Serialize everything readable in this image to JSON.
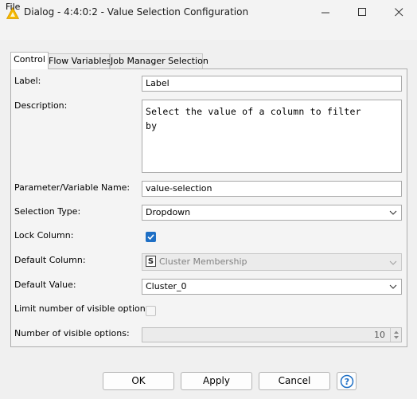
{
  "window": {
    "title": "Dialog - 4:4:0:2 - Value Selection Configuration",
    "minimize_icon": "minimize-icon",
    "maximize_icon": "maximize-icon",
    "close_icon": "close-icon"
  },
  "menu": {
    "file": "File"
  },
  "tabs": [
    {
      "label": "Control",
      "active": true
    },
    {
      "label": "Flow Variables",
      "active": false
    },
    {
      "label": "Job Manager Selection",
      "active": false
    }
  ],
  "form": {
    "label": {
      "label": "Label:",
      "value": "Label"
    },
    "description": {
      "label": "Description:",
      "value": "Select the value of a column to filter\nby"
    },
    "param_name": {
      "label": "Parameter/Variable Name:",
      "value": "value-selection"
    },
    "selection_type": {
      "label": "Selection Type:",
      "value": "Dropdown"
    },
    "lock_column": {
      "label": "Lock Column:",
      "checked": true
    },
    "default_column": {
      "label": "Default Column:",
      "type_badge": "S",
      "value": "Cluster Membership",
      "enabled": false
    },
    "default_value": {
      "label": "Default Value:",
      "value": "Cluster_0"
    },
    "limit_visible": {
      "label": "Limit number of visible options:",
      "checked": false
    },
    "num_visible": {
      "label": "Number of visible options:",
      "value": "10",
      "enabled": false
    }
  },
  "buttons": {
    "ok": "OK",
    "apply": "Apply",
    "cancel": "Cancel",
    "help_icon": "help-icon"
  },
  "colors": {
    "accent": "#1e6fc5",
    "app_icon": "#f5b800"
  }
}
